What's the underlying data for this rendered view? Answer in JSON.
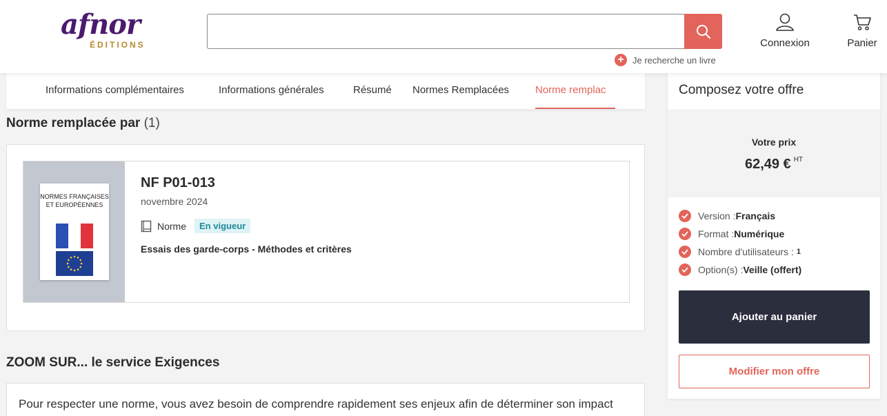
{
  "brand": {
    "logo_main": "afnor",
    "logo_sub": "ÉDITIONS"
  },
  "header": {
    "search": {
      "value": "",
      "placeholder": ""
    },
    "book_search_label": "Je recherche un livre",
    "login_label": "Connexion",
    "cart_label": "Panier"
  },
  "tabs": [
    {
      "label": "Informations complémentaires"
    },
    {
      "label": "Informations générales"
    },
    {
      "label": "Résumé"
    },
    {
      "label": "Normes Remplacées"
    },
    {
      "label": "Norme remplac"
    }
  ],
  "replaced_section": {
    "title": "Norme remplacée par",
    "count": "(1)",
    "item": {
      "cover_text": "NORMES FRANÇAISES ET EUROPÉENNES",
      "reference": "NF P01-013",
      "date": "novembre 2024",
      "type": "Norme",
      "status": "En vigueur",
      "title": "Essais des garde-corps - Méthodes et critères"
    }
  },
  "zoom": {
    "title": "ZOOM SUR... le service Exigences",
    "text": "Pour respecter une norme, vous avez besoin de comprendre rapidement ses enjeux afin de déterminer son impact"
  },
  "offer": {
    "title": "Composez votre offre",
    "price_label": "Votre prix",
    "price": "62,49 €",
    "price_suffix": "HT",
    "options": [
      {
        "label": "Version : ",
        "value": "Français"
      },
      {
        "label": "Format : ",
        "value": "Numérique"
      },
      {
        "label": "Nombre d'utilisateurs : ",
        "value": "1"
      },
      {
        "label": "Option(s) : ",
        "value": "Veille (offert)"
      }
    ],
    "add_to_cart": "Ajouter au panier",
    "modify": "Modifier mon offre"
  },
  "colors": {
    "accent": "#e2645a",
    "brand_purple": "#4b1a6e",
    "brand_gold": "#b58a2e",
    "dark_button": "#2a2e3d",
    "status_badge_bg": "#dff3f6",
    "status_badge_text": "#1f8a9a"
  }
}
